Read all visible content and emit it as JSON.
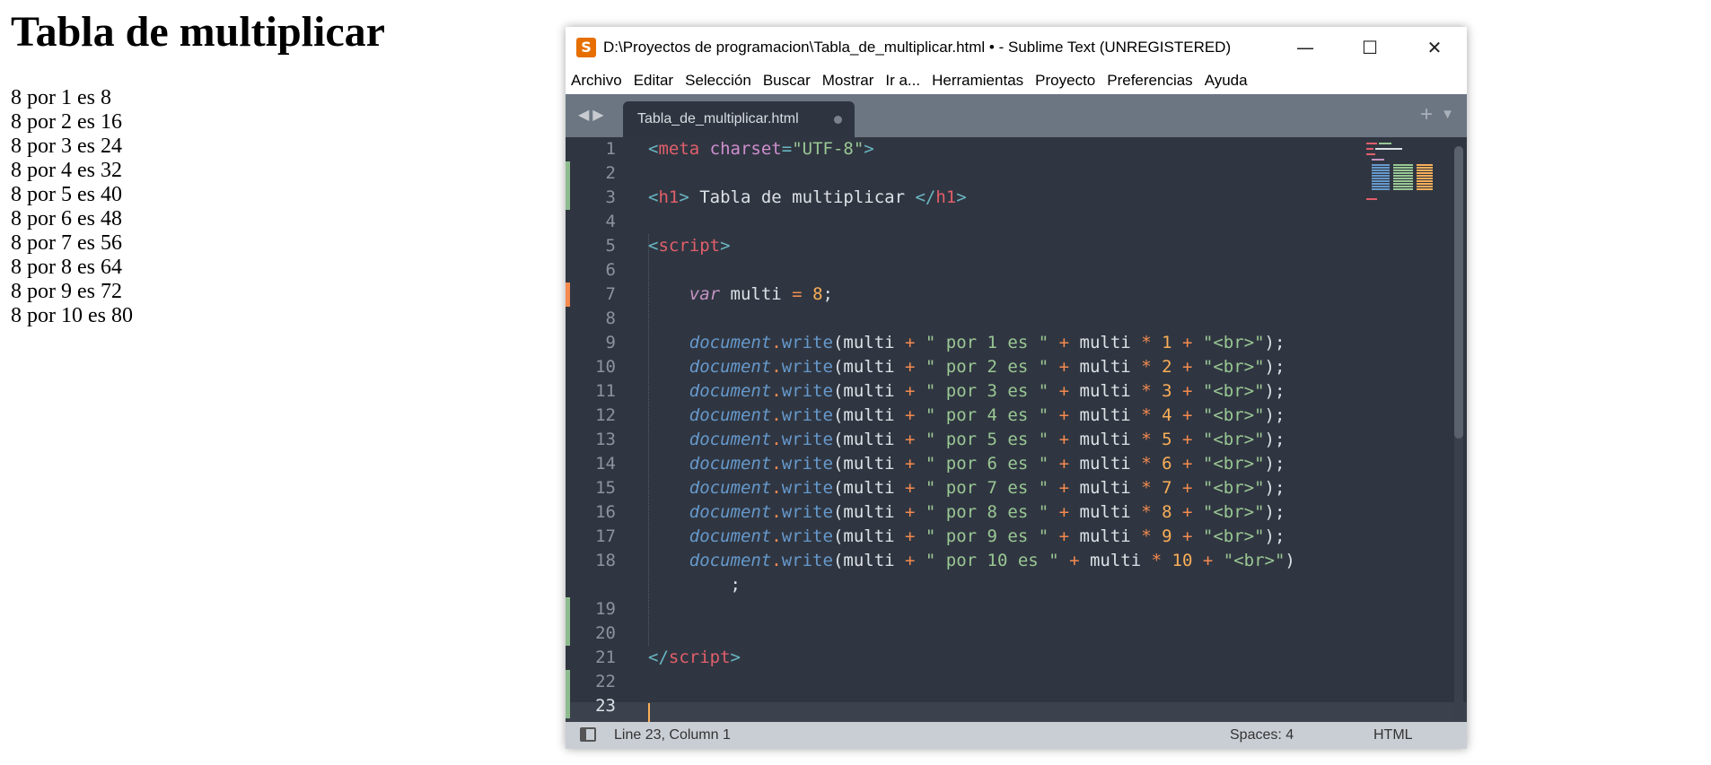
{
  "page": {
    "title": "Tabla de multiplicar",
    "lines": [
      "8 por 1 es 8",
      "8 por 2 es 16",
      "8 por 3 es 24",
      "8 por 4 es 32",
      "8 por 5 es 40",
      "8 por 6 es 48",
      "8 por 7 es 56",
      "8 por 8 es 64",
      "8 por 9 es 72",
      "8 por 10 es 80"
    ]
  },
  "window": {
    "title": "D:\\Proyectos de programacion\\Tabla_de_multiplicar.html • - Sublime Text (UNREGISTERED)",
    "app_icon": "S",
    "controls": {
      "minimize": "—",
      "maximize": "☐",
      "close": "✕"
    }
  },
  "menu": [
    "Archivo",
    "Editar",
    "Selección",
    "Buscar",
    "Mostrar",
    "Ir a...",
    "Herramientas",
    "Proyecto",
    "Preferencias",
    "Ayuda"
  ],
  "tab": {
    "label": "Tabla_de_multiplicar.html"
  },
  "editor": {
    "line_numbers": [
      "1",
      "2",
      "3",
      "4",
      "5",
      "6",
      "7",
      "8",
      "9",
      "10",
      "11",
      "12",
      "13",
      "14",
      "15",
      "16",
      "17",
      "18",
      "19",
      "20",
      "21",
      "22",
      "23"
    ],
    "current_line": 23
  },
  "status": {
    "position": "Line 23, Column 1",
    "spaces": "Spaces: 4",
    "syntax": "HTML"
  },
  "colors": {
    "editor_bg": "#303641",
    "tab_bar": "#6c7682",
    "status_bar": "#c9ced5",
    "modified_mark": "#f48a4f",
    "added_mark": "#8fbc8f"
  }
}
